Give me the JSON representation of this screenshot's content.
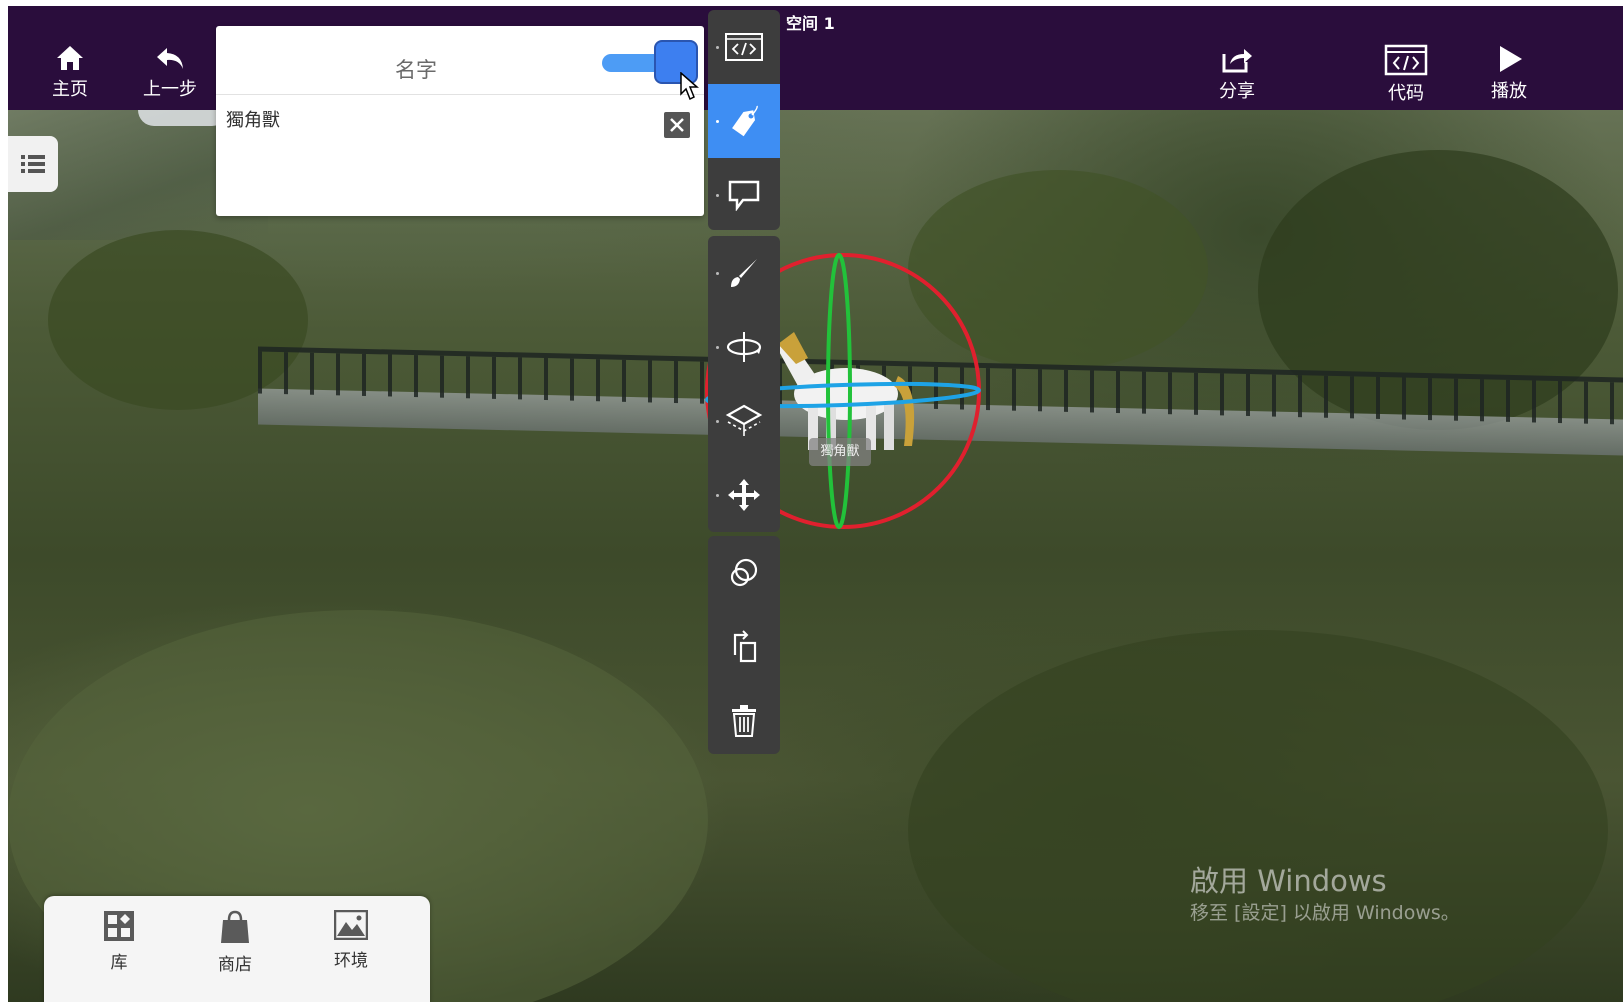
{
  "window": {
    "title": "空间 1"
  },
  "topbar": {
    "home_label": "主页",
    "back_label": "上一步",
    "share_label": "分享",
    "code_label": "代码",
    "play_label": "播放"
  },
  "name_panel": {
    "header": "名字",
    "value": "獨角獸",
    "toggle_on": true
  },
  "toolbar": {
    "items": [
      {
        "icon": "code-icon"
      },
      {
        "icon": "tag-icon",
        "active": true
      },
      {
        "icon": "speech-bubble-icon"
      },
      {
        "icon": "paint-brush-icon"
      },
      {
        "icon": "rotate-icon"
      },
      {
        "icon": "layers-icon"
      },
      {
        "icon": "move-icon"
      },
      {
        "icon": "link-icon"
      },
      {
        "icon": "duplicate-icon"
      },
      {
        "icon": "trash-icon"
      }
    ]
  },
  "scene": {
    "object_label": "獨角獸"
  },
  "bottombar": {
    "library_label": "库",
    "shop_label": "商店",
    "environment_label": "环境"
  },
  "watermark": {
    "title": "啟用 Windows",
    "subtitle": "移至 [設定] 以啟用 Windows。"
  },
  "colors": {
    "topbar_bg": "#2a0d3c",
    "accent_blue": "#3e8ef3",
    "toolbar_bg": "#3d3d3d",
    "gizmo_red": "#e0202e",
    "gizmo_green": "#22c23a",
    "gizmo_blue": "#1ea3e6"
  }
}
